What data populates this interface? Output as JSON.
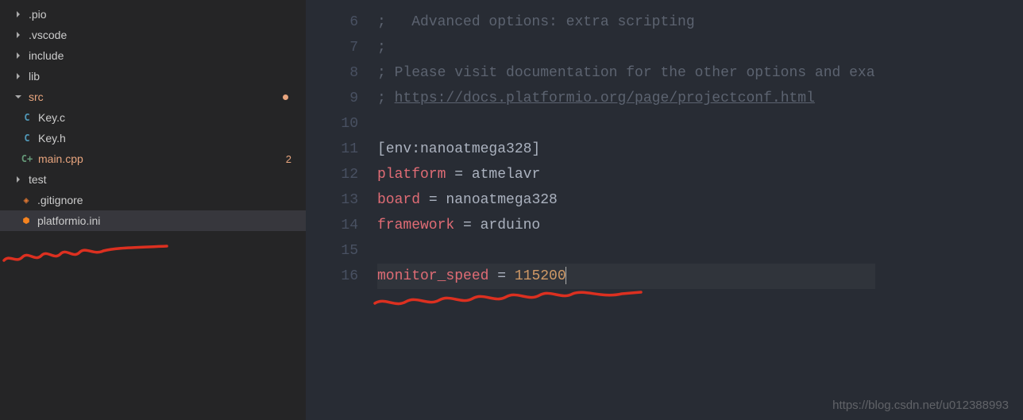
{
  "sidebar": {
    "items": [
      {
        "type": "folder",
        "label": ".pio",
        "expanded": false
      },
      {
        "type": "folder",
        "label": ".vscode",
        "expanded": false
      },
      {
        "type": "folder",
        "label": "include",
        "expanded": false
      },
      {
        "type": "folder",
        "label": "lib",
        "expanded": false
      },
      {
        "type": "folder",
        "label": "src",
        "expanded": true,
        "modified": true
      },
      {
        "type": "file",
        "label": "Key.c",
        "icon": "C",
        "iconClass": "c"
      },
      {
        "type": "file",
        "label": "Key.h",
        "icon": "C",
        "iconClass": "c"
      },
      {
        "type": "file",
        "label": "main.cpp",
        "icon": "C+",
        "iconClass": "cpp",
        "badge": "2",
        "modified": true
      },
      {
        "type": "folder",
        "label": "test",
        "expanded": false
      },
      {
        "type": "file",
        "label": ".gitignore",
        "icon": "◈",
        "iconClass": "git",
        "root": true
      },
      {
        "type": "file",
        "label": "platformio.ini",
        "icon": "⬢",
        "iconClass": "pio",
        "root": true,
        "active": true
      }
    ]
  },
  "editor": {
    "startLine": 6,
    "lines": [
      {
        "n": 6,
        "segments": [
          {
            "t": ";   Advanced options: extra scripting",
            "c": "comment"
          }
        ]
      },
      {
        "n": 7,
        "segments": [
          {
            "t": ";",
            "c": "comment"
          }
        ]
      },
      {
        "n": 8,
        "segments": [
          {
            "t": "; Please visit documentation for the other options and exa",
            "c": "comment"
          }
        ]
      },
      {
        "n": 9,
        "segments": [
          {
            "t": "; ",
            "c": "comment"
          },
          {
            "t": "https://docs.platformio.org/page/projectconf.html",
            "c": "link"
          }
        ]
      },
      {
        "n": 10,
        "segments": []
      },
      {
        "n": 11,
        "segments": [
          {
            "t": "[env:nanoatmega328]",
            "c": "section"
          }
        ]
      },
      {
        "n": 12,
        "segments": [
          {
            "t": "platform",
            "c": "key"
          },
          {
            "t": " = ",
            "c": "equals"
          },
          {
            "t": "atmelavr",
            "c": "value"
          }
        ]
      },
      {
        "n": 13,
        "segments": [
          {
            "t": "board",
            "c": "key"
          },
          {
            "t": " = ",
            "c": "equals"
          },
          {
            "t": "nanoatmega328",
            "c": "value"
          }
        ]
      },
      {
        "n": 14,
        "segments": [
          {
            "t": "framework",
            "c": "key"
          },
          {
            "t": " = ",
            "c": "equals"
          },
          {
            "t": "arduino",
            "c": "value"
          }
        ]
      },
      {
        "n": 15,
        "segments": []
      },
      {
        "n": 16,
        "segments": [
          {
            "t": "monitor_speed",
            "c": "key"
          },
          {
            "t": " = ",
            "c": "equals"
          },
          {
            "t": "115200",
            "c": "number"
          }
        ],
        "cursor": true,
        "hl": true
      }
    ]
  },
  "watermark": "https://blog.csdn.net/u012388993"
}
